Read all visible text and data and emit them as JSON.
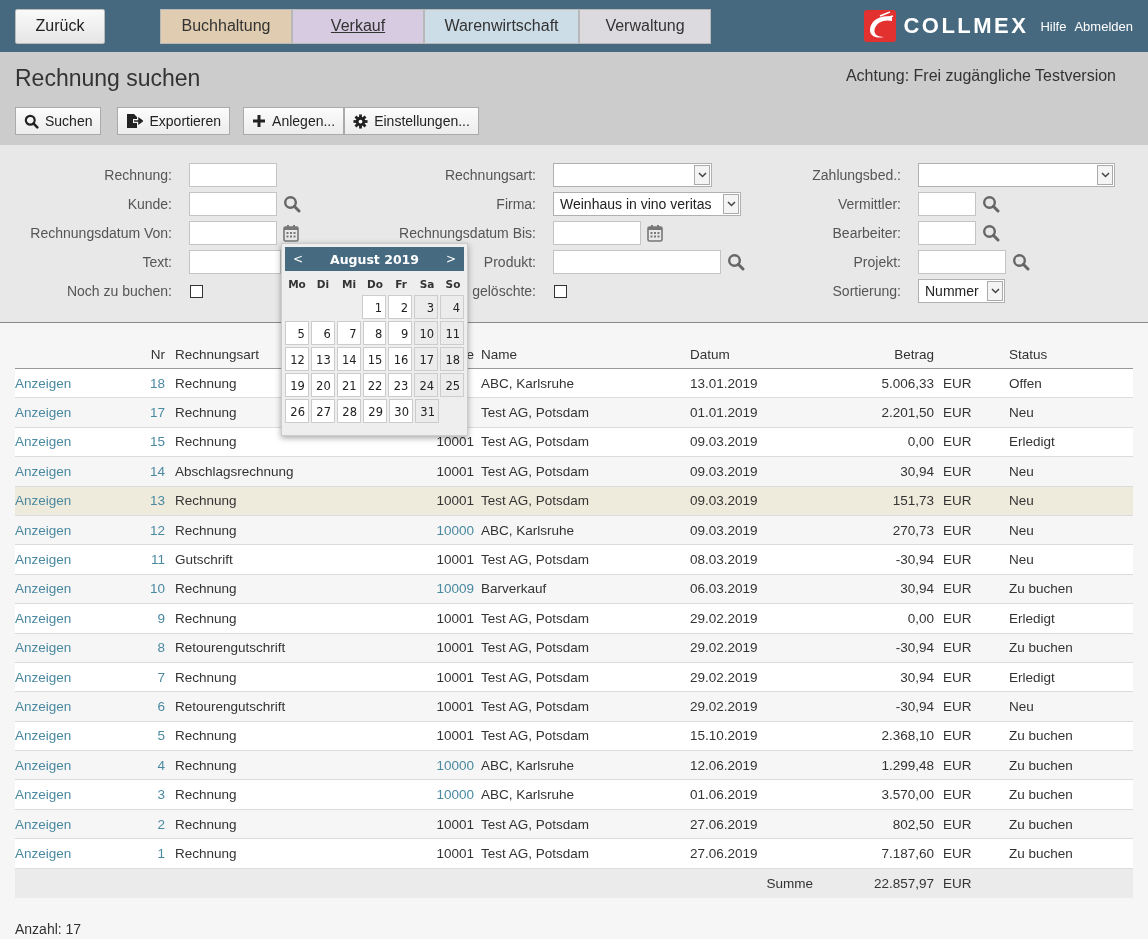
{
  "top_bar": {
    "back_button": "Zurück",
    "tabs": [
      {
        "label": "Buchhaltung",
        "selected": false,
        "color": "#e0ccb0"
      },
      {
        "label": "Verkauf",
        "selected": true,
        "color": "#d6cbe0"
      },
      {
        "label": "Warenwirtschaft",
        "selected": false,
        "color": "#cddde8"
      },
      {
        "label": "Verwaltung",
        "selected": false,
        "color": "#dcdadf"
      }
    ],
    "logo": "COLLMEX",
    "links": [
      "Hilfe",
      "Abmelden"
    ]
  },
  "page": {
    "title": "Rechnung suchen",
    "notice": "Achtung: Frei zugängliche Testversion"
  },
  "toolbar": [
    {
      "label": "Suchen",
      "kind": "search"
    },
    {
      "label": "Exportieren",
      "kind": "export"
    },
    {
      "label": "Anlegen...",
      "kind": "create"
    },
    {
      "label": "Einstellungen...",
      "kind": "settings"
    }
  ],
  "filters": [
    [
      {
        "label": "Rechnung:",
        "kind": "text"
      },
      {
        "label": "Kunde:",
        "kind": "search"
      },
      {
        "label": "Rechnungsdatum Von:",
        "kind": "date"
      },
      {
        "label": "Text:",
        "kind": "text"
      },
      {
        "label": "Noch zu buchen:",
        "kind": "checkbox",
        "checked": false
      }
    ],
    [
      {
        "label": "Rechnungsart:",
        "kind": "select"
      },
      {
        "label": "Firma:",
        "kind": "select",
        "value": "Weinhaus in vino veritas"
      },
      {
        "label": "Rechnungsdatum Bis:",
        "kind": "date"
      },
      {
        "label": "Produkt:",
        "kind": "search"
      },
      {
        "label": "gelöschte:",
        "kind": "checkbox",
        "checked": false
      }
    ],
    [
      {
        "label": "Zahlungsbed.:",
        "kind": "select"
      },
      {
        "label": "Vermittler:",
        "kind": "search"
      },
      {
        "label": "Bearbeiter:",
        "kind": "search"
      },
      {
        "label": "Projekt:",
        "kind": "search"
      },
      {
        "label": "Sortierung:",
        "kind": "select",
        "value": "Nummer"
      }
    ]
  ],
  "calendar": {
    "prev": "<",
    "month": "August 2019",
    "next": ">",
    "weekdays": [
      "Mo",
      "Di",
      "Mi",
      "Do",
      "Fr",
      "Sa",
      "So"
    ],
    "weeks": [
      [
        "1",
        "2",
        "3",
        "4"
      ],
      [
        "5",
        "6",
        "7",
        "8",
        "9",
        "10",
        "11"
      ],
      [
        "12",
        "13",
        "14",
        "15",
        "16",
        "17",
        "18"
      ],
      [
        "19",
        "20",
        "21",
        "22",
        "23",
        "24",
        "25"
      ],
      [
        "26",
        "27",
        "28",
        "29",
        "30",
        "31"
      ]
    ]
  },
  "table": {
    "columns": {
      "nr": "Nr",
      "type": "Rechnungsart",
      "customer": "e",
      "name": "Name",
      "date": "Datum",
      "amount": "Betrag",
      "status": "Status"
    },
    "rows": [
      {
        "action": "Anzeigen",
        "nr": "18",
        "type": "Rechnung",
        "name": "ABC, Karlsruhe",
        "date": "13.01.2019",
        "amount": "5.006,33",
        "currency": "EUR",
        "status": "Offen",
        "selected": false
      },
      {
        "action": "Anzeigen",
        "nr": "17",
        "type": "Rechnung",
        "name": "Test AG, Potsdam",
        "date": "01.01.2019",
        "amount": "2.201,50",
        "currency": "EUR",
        "status": "Neu",
        "selected": false
      },
      {
        "action": "Anzeigen",
        "nr": "15",
        "type": "Rechnung",
        "customer": "10001",
        "customer_linked": false,
        "name": "Test AG, Potsdam",
        "date": "09.03.2019",
        "amount": "0,00",
        "currency": "EUR",
        "status": "Erledigt",
        "selected": false
      },
      {
        "action": "Anzeigen",
        "nr": "14",
        "type": "Abschlagsrechnung",
        "customer": "10001",
        "customer_linked": false,
        "name": "Test AG, Potsdam",
        "date": "09.03.2019",
        "amount": "30,94",
        "currency": "EUR",
        "status": "Neu",
        "selected": false
      },
      {
        "action": "Anzeigen",
        "nr": "13",
        "type": "Rechnung",
        "customer": "10001",
        "customer_linked": false,
        "name": "Test AG, Potsdam",
        "date": "09.03.2019",
        "amount": "151,73",
        "currency": "EUR",
        "status": "Neu",
        "selected": true
      },
      {
        "action": "Anzeigen",
        "nr": "12",
        "type": "Rechnung",
        "customer": "10000",
        "customer_linked": true,
        "name": "ABC, Karlsruhe",
        "date": "09.03.2019",
        "amount": "270,73",
        "currency": "EUR",
        "status": "Neu",
        "selected": false
      },
      {
        "action": "Anzeigen",
        "nr": "11",
        "type": "Gutschrift",
        "customer": "10001",
        "customer_linked": false,
        "name": "Test AG, Potsdam",
        "date": "08.03.2019",
        "amount": "-30,94",
        "currency": "EUR",
        "status": "Neu",
        "selected": false
      },
      {
        "action": "Anzeigen",
        "nr": "10",
        "type": "Rechnung",
        "customer": "10009",
        "customer_linked": true,
        "name": "Barverkauf",
        "date": "06.03.2019",
        "amount": "30,94",
        "currency": "EUR",
        "status": "Zu buchen",
        "selected": false
      },
      {
        "action": "Anzeigen",
        "nr": "9",
        "type": "Rechnung",
        "customer": "10001",
        "customer_linked": false,
        "name": "Test AG, Potsdam",
        "date": "29.02.2019",
        "amount": "0,00",
        "currency": "EUR",
        "status": "Erledigt",
        "selected": false
      },
      {
        "action": "Anzeigen",
        "nr": "8",
        "type": "Retourengutschrift",
        "customer": "10001",
        "customer_linked": false,
        "name": "Test AG, Potsdam",
        "date": "29.02.2019",
        "amount": "-30,94",
        "currency": "EUR",
        "status": "Zu buchen",
        "selected": false
      },
      {
        "action": "Anzeigen",
        "nr": "7",
        "type": "Rechnung",
        "customer": "10001",
        "customer_linked": false,
        "name": "Test AG, Potsdam",
        "date": "29.02.2019",
        "amount": "30,94",
        "currency": "EUR",
        "status": "Erledigt",
        "selected": false
      },
      {
        "action": "Anzeigen",
        "nr": "6",
        "type": "Retourengutschrift",
        "customer": "10001",
        "customer_linked": false,
        "name": "Test AG, Potsdam",
        "date": "29.02.2019",
        "amount": "-30,94",
        "currency": "EUR",
        "status": "Neu",
        "selected": false
      },
      {
        "action": "Anzeigen",
        "nr": "5",
        "type": "Rechnung",
        "customer": "10001",
        "customer_linked": false,
        "name": "Test AG, Potsdam",
        "date": "15.10.2019",
        "amount": "2.368,10",
        "currency": "EUR",
        "status": "Zu buchen",
        "selected": false
      },
      {
        "action": "Anzeigen",
        "nr": "4",
        "type": "Rechnung",
        "customer": "10000",
        "customer_linked": true,
        "name": "ABC, Karlsruhe",
        "date": "12.06.2019",
        "amount": "1.299,48",
        "currency": "EUR",
        "status": "Zu buchen",
        "selected": false
      },
      {
        "action": "Anzeigen",
        "nr": "3",
        "type": "Rechnung",
        "customer": "10000",
        "customer_linked": true,
        "name": "ABC, Karlsruhe",
        "date": "01.06.2019",
        "amount": "3.570,00",
        "currency": "EUR",
        "status": "Zu buchen",
        "selected": false
      },
      {
        "action": "Anzeigen",
        "nr": "2",
        "type": "Rechnung",
        "customer": "10001",
        "customer_linked": false,
        "name": "Test AG, Potsdam",
        "date": "27.06.2019",
        "amount": "802,50",
        "currency": "EUR",
        "status": "Zu buchen",
        "selected": false
      },
      {
        "action": "Anzeigen",
        "nr": "1",
        "type": "Rechnung",
        "customer": "10001",
        "customer_linked": false,
        "name": "Test AG, Potsdam",
        "date": "27.06.2019",
        "amount": "7.187,60",
        "currency": "EUR",
        "status": "Zu buchen",
        "selected": false
      }
    ],
    "total": {
      "label": "Summe",
      "amount": "22.857,97",
      "currency": "EUR"
    }
  },
  "count": "Anzahl: 17"
}
